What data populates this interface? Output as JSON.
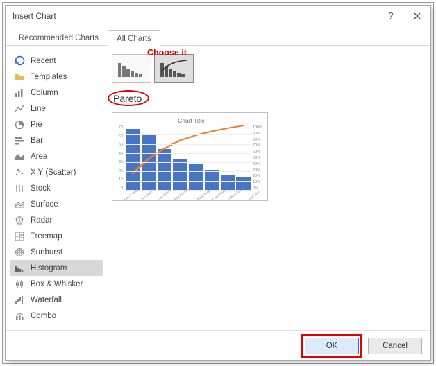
{
  "dialog": {
    "title": "Insert Chart",
    "tabs": {
      "recommended": "Recommended Charts",
      "all": "All Charts"
    },
    "annotation": "Choose it",
    "chart_subtitle": "Pareto",
    "footer": {
      "ok": "OK",
      "cancel": "Cancel"
    }
  },
  "sidebar": {
    "items": [
      {
        "label": "Recent"
      },
      {
        "label": "Templates"
      },
      {
        "label": "Column"
      },
      {
        "label": "Line"
      },
      {
        "label": "Pie"
      },
      {
        "label": "Bar"
      },
      {
        "label": "Area"
      },
      {
        "label": "X Y (Scatter)"
      },
      {
        "label": "Stock"
      },
      {
        "label": "Surface"
      },
      {
        "label": "Radar"
      },
      {
        "label": "Treemap"
      },
      {
        "label": "Sunburst"
      },
      {
        "label": "Histogram"
      },
      {
        "label": "Box & Whisker"
      },
      {
        "label": "Waterfall"
      },
      {
        "label": "Combo"
      }
    ]
  },
  "chart_data": {
    "type": "bar",
    "title": "Chart Title",
    "y_left": [
      "70",
      "60",
      "50",
      "40",
      "30",
      "20",
      "10",
      "0"
    ],
    "y_right": [
      "100%",
      "90%",
      "80%",
      "70%",
      "60%",
      "50%",
      "40%",
      "30%",
      "20%",
      "10%",
      "0%"
    ],
    "categories": [
      "Out of stock",
      "Too much…",
      "Low Quality",
      "Bad Customer…",
      "Many Bugs",
      "Overpriced",
      "Difficult To Use",
      "Bad User…"
    ],
    "values": [
      60,
      55,
      40,
      30,
      25,
      20,
      15,
      12
    ],
    "cumulative_pct": [
      25,
      48,
      64,
      77,
      85,
      91,
      96,
      100
    ]
  }
}
